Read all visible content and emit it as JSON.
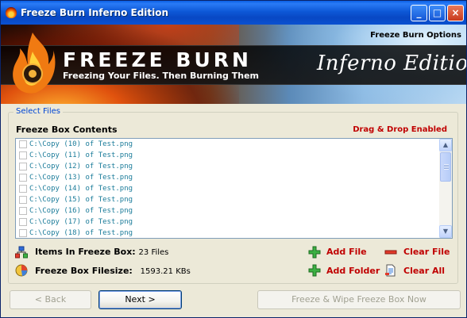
{
  "window": {
    "title": "Freeze Burn Inferno Edition",
    "controls": {
      "minimize": "_",
      "maximize": "□",
      "close": "×"
    }
  },
  "banner": {
    "options_link": "Freeze Burn Options",
    "product_name": "FREEZE BURN",
    "tagline": "Freezing Your Files. Then Burning Them",
    "edition": "Inferno Edition"
  },
  "files": {
    "group_label": "Select Files",
    "list_title": "Freeze Box Contents",
    "drag_drop": "Drag & Drop Enabled",
    "items": [
      "C:\\Copy (10) of Test.png",
      "C:\\Copy (11) of Test.png",
      "C:\\Copy (12) of Test.png",
      "C:\\Copy (13) of Test.png",
      "C:\\Copy (14) of Test.png",
      "C:\\Copy (15) of Test.png",
      "C:\\Copy (16) of Test.png",
      "C:\\Copy (17) of Test.png",
      "C:\\Copy (18) of Test.png"
    ],
    "scrollbar": {
      "up": "▲",
      "down": "▼"
    }
  },
  "stats": {
    "items_label": "Items In Freeze Box:",
    "items_value": "23 Files",
    "size_label": "Freeze Box Filesize:",
    "size_value": "1593.21 KBs"
  },
  "actions": {
    "add_file": "Add File",
    "clear_file": "Clear File",
    "add_folder": "Add Folder",
    "clear_all": "Clear All"
  },
  "buttons": {
    "back": "< Back",
    "next": "Next >",
    "wipe": "Freeze & Wipe Freeze Box Now"
  },
  "colors": {
    "title_bar": "#0A58D8",
    "accent_red": "#C00000",
    "list_text": "#1B7C9A",
    "group_label": "#0046D5"
  }
}
